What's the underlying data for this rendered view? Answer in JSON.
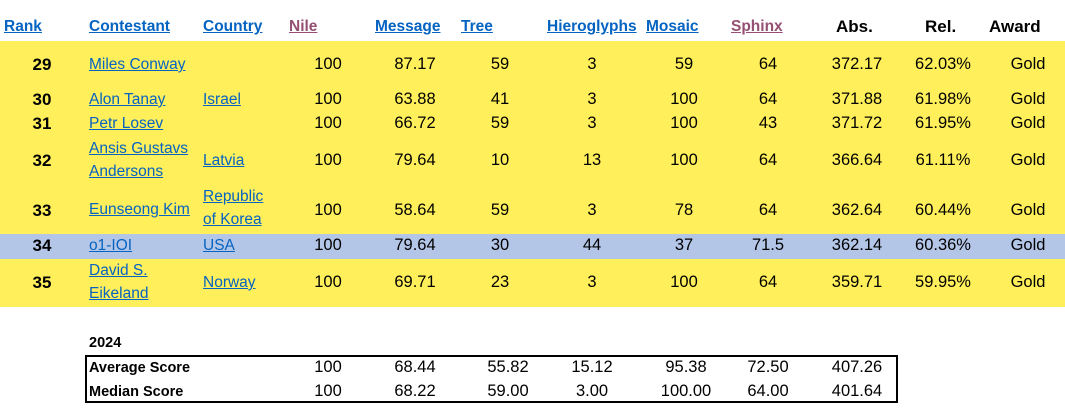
{
  "headers": {
    "rank": "Rank",
    "contestant": "Contestant",
    "country": "Country",
    "nile": "Nile",
    "message": "Message",
    "tree": "Tree",
    "hieroglyphs": "Hieroglyphs",
    "mosaic": "Mosaic",
    "sphinx": "Sphinx",
    "abs": "Abs.",
    "rel": "Rel.",
    "award": "Award"
  },
  "rows": [
    {
      "rank": "29",
      "name1": "Miles Conway",
      "name2": "",
      "country1": "",
      "country2": "",
      "nile": "100",
      "message": "87.17",
      "tree": "59",
      "hieroglyphs": "3",
      "mosaic": "59",
      "sphinx": "64",
      "abs": "372.17",
      "rel": "62.03%",
      "award": "Gold"
    },
    {
      "rank": "30",
      "name1": "Alon Tanay",
      "name2": "",
      "country1": "Israel",
      "country2": "",
      "nile": "100",
      "message": "63.88",
      "tree": "41",
      "hieroglyphs": "3",
      "mosaic": "100",
      "sphinx": "64",
      "abs": "371.88",
      "rel": "61.98%",
      "award": "Gold"
    },
    {
      "rank": "31",
      "name1": "Petr Losev",
      "name2": "",
      "country1": "",
      "country2": "",
      "nile": "100",
      "message": "66.72",
      "tree": "59",
      "hieroglyphs": "3",
      "mosaic": "100",
      "sphinx": "43",
      "abs": "371.72",
      "rel": "61.95%",
      "award": "Gold"
    },
    {
      "rank": "32",
      "name1": "Ansis Gustavs",
      "name2": "Andersons",
      "country1": "Latvia",
      "country2": "",
      "nile": "100",
      "message": "79.64",
      "tree": "10",
      "hieroglyphs": "13",
      "mosaic": "100",
      "sphinx": "64",
      "abs": "366.64",
      "rel": "61.11%",
      "award": "Gold"
    },
    {
      "rank": "33",
      "name1": "Eunseong Kim",
      "name2": "",
      "country1": "Republic",
      "country2": "of Korea",
      "nile": "100",
      "message": "58.64",
      "tree": "59",
      "hieroglyphs": "3",
      "mosaic": "78",
      "sphinx": "64",
      "abs": "362.64",
      "rel": "60.44%",
      "award": "Gold"
    },
    {
      "rank": "34",
      "name1": "o1-IOI",
      "name2": "",
      "country1": "USA",
      "country2": "",
      "nile": "100",
      "message": "79.64",
      "tree": "30",
      "hieroglyphs": "44",
      "mosaic": "37",
      "sphinx": "71.5",
      "abs": "362.14",
      "rel": "60.36%",
      "award": "Gold"
    },
    {
      "rank": "35",
      "name1": "David S.",
      "name2": "Eikeland",
      "country1": "Norway",
      "country2": "",
      "nile": "100",
      "message": "69.71",
      "tree": "23",
      "hieroglyphs": "3",
      "mosaic": "100",
      "sphinx": "64",
      "abs": "359.71",
      "rel": "59.95%",
      "award": "Gold"
    }
  ],
  "summary": {
    "year": "2024",
    "average": {
      "label": "Average Score",
      "nile": "100",
      "message": "68.44",
      "tree": "55.82",
      "hieroglyphs": "15.12",
      "mosaic": "95.38",
      "sphinx": "72.50",
      "abs": "407.26"
    },
    "median": {
      "label": "Median Score",
      "nile": "100",
      "message": "68.22",
      "tree": "59.00",
      "hieroglyphs": "3.00",
      "mosaic": "100.00",
      "sphinx": "64.00",
      "abs": "401.64"
    }
  },
  "colors": {
    "yellow_row": "#ffef5a",
    "highlight_row": "#b4c6e7",
    "link": "#0563c1",
    "visited_link": "#954f72"
  }
}
